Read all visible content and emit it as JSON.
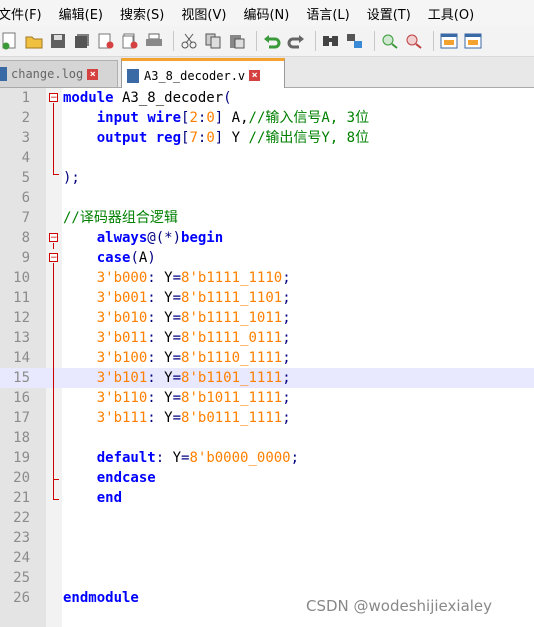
{
  "menubar": {
    "items": [
      "文件(F)",
      "编辑(E)",
      "搜索(S)",
      "视图(V)",
      "编码(N)",
      "语言(L)",
      "设置(T)",
      "工具(O)"
    ]
  },
  "toolbar": {
    "icons": [
      "new-file-icon",
      "open-file-icon",
      "save-icon",
      "save-all-icon",
      "close-icon",
      "close-all-icon",
      "print-icon",
      "cut-icon",
      "copy-icon",
      "paste-icon",
      "undo-icon",
      "redo-icon",
      "find-icon",
      "replace-icon",
      "zoom-in-icon",
      "zoom-out-icon",
      "sync-vertical-icon",
      "sync-horizontal-icon"
    ]
  },
  "tabs": [
    {
      "label": "change.log",
      "active": false
    },
    {
      "label": "A3_8_decoder.v",
      "active": true
    }
  ],
  "editor": {
    "current_line": 15,
    "lines": [
      {
        "n": "1",
        "text": "module A3_8_decoder("
      },
      {
        "n": "2",
        "text": "    input wire[2:0] A,//输入信号A, 3位"
      },
      {
        "n": "3",
        "text": "    output reg[7:0] Y //输出信号Y, 8位"
      },
      {
        "n": "4",
        "text": ""
      },
      {
        "n": "5",
        "text": ");"
      },
      {
        "n": "6",
        "text": ""
      },
      {
        "n": "7",
        "text": "//译码器组合逻辑"
      },
      {
        "n": "8",
        "text": "    always@(*)begin"
      },
      {
        "n": "9",
        "text": "    case(A)"
      },
      {
        "n": "10",
        "text": "    3'b000: Y=8'b1111_1110;"
      },
      {
        "n": "11",
        "text": "    3'b001: Y=8'b1111_1101;"
      },
      {
        "n": "12",
        "text": "    3'b010: Y=8'b1111_1011;"
      },
      {
        "n": "13",
        "text": "    3'b011: Y=8'b1111_0111;"
      },
      {
        "n": "14",
        "text": "    3'b100: Y=8'b1110_1111;"
      },
      {
        "n": "15",
        "text": "    3'b101: Y=8'b1101_1111;"
      },
      {
        "n": "16",
        "text": "    3'b110: Y=8'b1011_1111;"
      },
      {
        "n": "17",
        "text": "    3'b111: Y=8'b0111_1111;"
      },
      {
        "n": "18",
        "text": ""
      },
      {
        "n": "19",
        "text": "    default: Y=8'b0000_0000;"
      },
      {
        "n": "20",
        "text": "    endcase"
      },
      {
        "n": "21",
        "text": "    end"
      },
      {
        "n": "22",
        "text": ""
      },
      {
        "n": "23",
        "text": ""
      },
      {
        "n": "24",
        "text": ""
      },
      {
        "n": "25",
        "text": ""
      },
      {
        "n": "26",
        "text": "endmodule"
      }
    ]
  },
  "watermark": "CSDN @wodeshijiexialey",
  "colors": {
    "keyword": "#0000ff",
    "number": "#ff8000",
    "comment": "#008000",
    "active_tab_accent": "#f4a22f",
    "current_line_bg": "#e8e8ff"
  }
}
